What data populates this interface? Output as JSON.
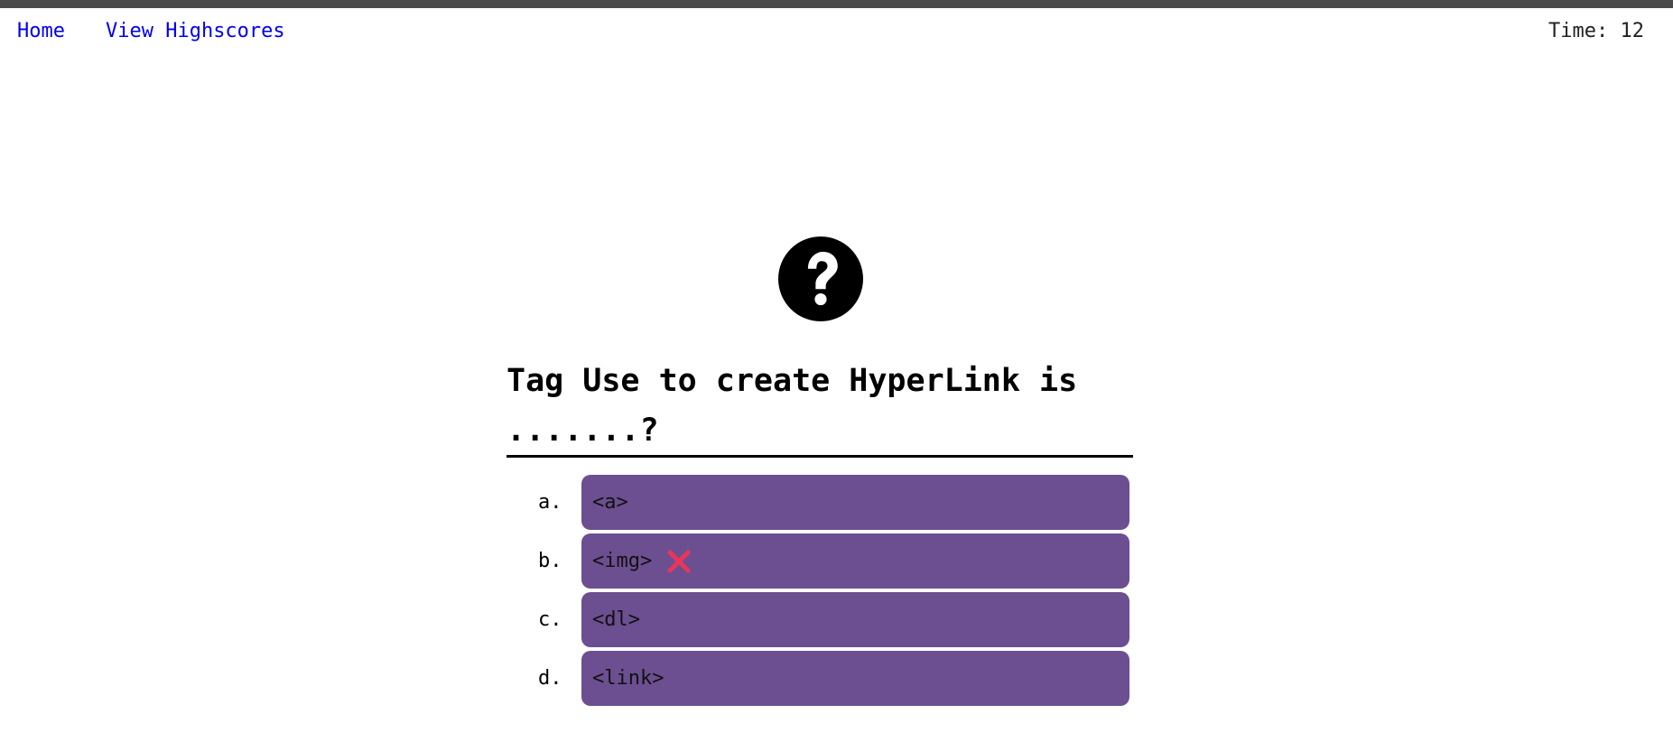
{
  "nav": {
    "home_label": "Home",
    "highscores_label": "View Highscores"
  },
  "timer": {
    "text": "Time: 12"
  },
  "question": {
    "icon": "question-circle-icon",
    "line1": "Tag Use to create HyperLink is",
    "line2": ".......?"
  },
  "answers": [
    {
      "letter": "a.",
      "text": "<a>"
    },
    {
      "letter": "b.",
      "text": "<img>",
      "marked": "wrong-x-icon"
    },
    {
      "letter": "c.",
      "text": "<dl>"
    },
    {
      "letter": "d.",
      "text": "<link>"
    }
  ],
  "colors": {
    "choice_bg": "#6b4f90",
    "link": "#0000ee",
    "wrong_mark": "#e8365a"
  }
}
